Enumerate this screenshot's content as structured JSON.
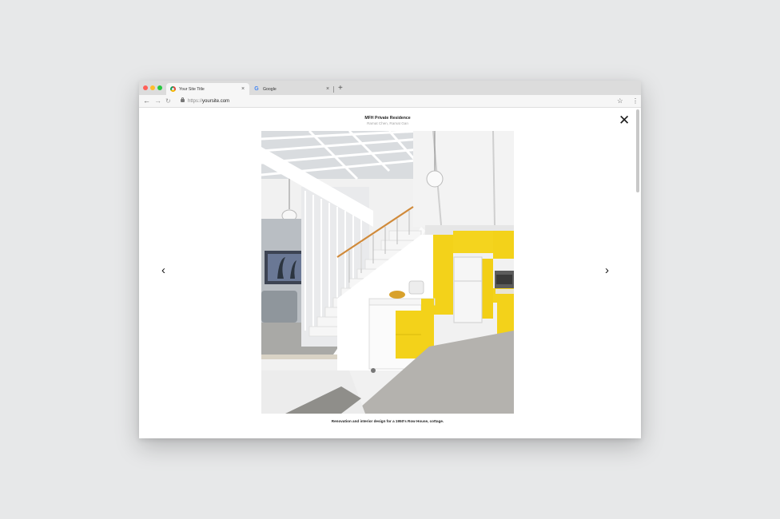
{
  "browser": {
    "tabs": [
      {
        "label": "Your Site Title",
        "icon": "chrome-icon",
        "active": true
      },
      {
        "label": "Google",
        "icon": "google-icon",
        "active": false
      }
    ],
    "close_glyph": "×",
    "new_tab_glyph": "+",
    "url_protocol": "https://",
    "url_host": "yoursite.com",
    "nav": {
      "back": "←",
      "forward": "→",
      "reload": "↻"
    },
    "star_glyph": "☆",
    "menu_glyph": "⋮"
  },
  "lightbox": {
    "title": "MFH Private Residence",
    "subtitle": "Ramat Chen, Ramat Gan",
    "caption": "Renovation and interior design for a 1950's Row House, cottage.",
    "close_glyph": "✕",
    "prev_glyph": "‹",
    "next_glyph": "›",
    "photo_subject": "interior-staircase-yellow-kitchen"
  },
  "colors": {
    "accent_yellow": "#f3d21a",
    "backdrop": "#e7e8e9"
  }
}
